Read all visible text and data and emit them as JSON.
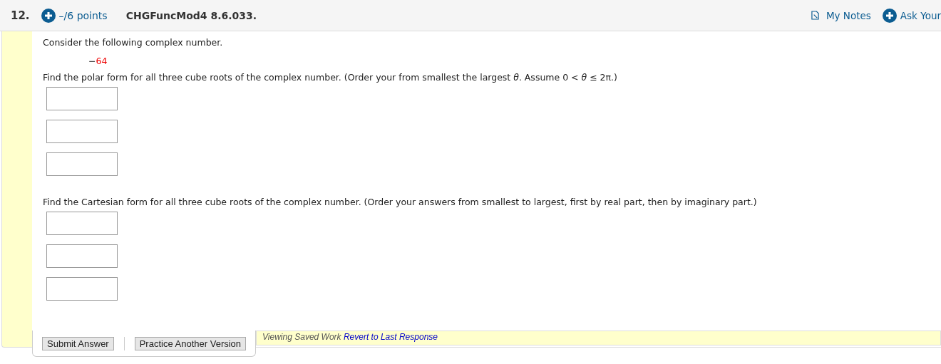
{
  "header": {
    "number": "12.",
    "points": "–/6 points",
    "code": "CHGFuncMod4 8.6.033.",
    "notes": "My Notes",
    "ask": "Ask Your"
  },
  "intro": "Consider the following complex number.",
  "complex_number": {
    "sign": "−",
    "value": "64"
  },
  "parts": [
    {
      "prompt": "Find the polar form for all three cube roots of the complex number. (Order your from smallest the largest *θ*. Assume  0 < *θ* ≤ 2π.)",
      "answers": [
        {
          "kind": "text_input"
        },
        {
          "kind": "text_input"
        },
        {
          "kind": "text_input"
        }
      ]
    },
    {
      "prompt": "Find the Cartesian form for all three cube roots of the complex number. (Order your answers from smallest to largest, first by real part, then by imaginary part.)",
      "answers": [
        {
          "kind": "text_input"
        },
        {
          "kind": "text_input"
        },
        {
          "kind": "text_input"
        }
      ]
    }
  ],
  "buttons": [
    "Submit Answer",
    "Practice Another Version"
  ],
  "saved": {
    "status": "Viewing Saved Work",
    "link": "Revert to Last Response"
  }
}
